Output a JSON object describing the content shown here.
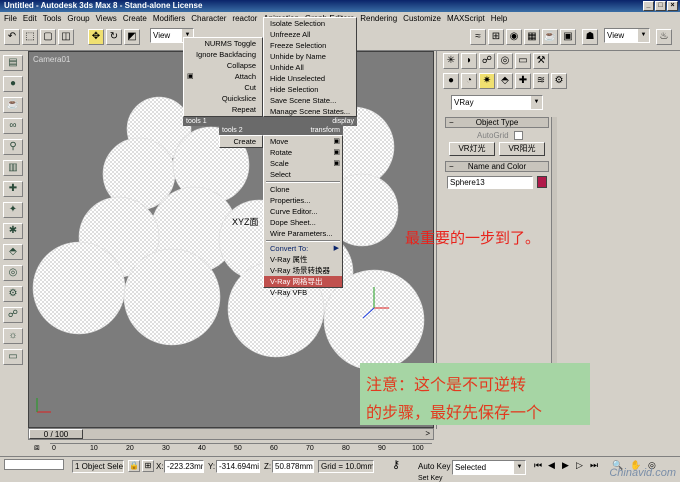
{
  "window": {
    "title": "Untitled - Autodesk 3ds Max 8  -  Stand-alone License",
    "controls": [
      "_",
      "□",
      "×"
    ]
  },
  "menubar": [
    "File",
    "Edit",
    "Tools",
    "Group",
    "Views",
    "Create",
    "Modifiers",
    "Character",
    "reactor",
    "Animation",
    "Graph Editors",
    "Rendering",
    "Customize",
    "MAXScript",
    "Help"
  ],
  "toolbar": {
    "view_combo": "View",
    "view_combo_right": "View"
  },
  "viewport": {
    "label": "Camera01",
    "center_label": "XYZ面"
  },
  "quad_left": {
    "items": [
      "NURMS Toggle",
      "Ignore Backfacing",
      "Collapse",
      "Attach",
      "Cut",
      "Quickslice",
      "Repeat"
    ],
    "header_left": "tools 1",
    "header2": "tools 2",
    "create": "Create"
  },
  "quad_right": {
    "items_top": [
      "Isolate Selection",
      "Unfreeze All",
      "Freeze Selection",
      "Unhide by Name",
      "Unhide All",
      "Hide Unselected",
      "Hide Selection",
      "Save Scene State...",
      "Manage Scene States..."
    ],
    "header_display": "display",
    "header_transform": "transform",
    "items_bottom": [
      "Move",
      "Rotate",
      "Scale",
      "Select",
      "Clone",
      "Properties...",
      "Curve Editor...",
      "Dope Sheet...",
      "Wire Parameters...",
      "Convert To:",
      "V-Ray 属性",
      "V-Ray 场景转换器",
      "V-Ray 网格导出",
      "V-Ray VFB"
    ]
  },
  "cmdpanel": {
    "renderer_combo": "VRay",
    "object_type_header": "Object Type",
    "autogrid": "AutoGrid",
    "btn_vrlight": "VR灯光",
    "btn_vrsun": "VR阳光",
    "name_color_header": "Name and Color",
    "object_name": "Sphere13",
    "object_color": "#b01a4a"
  },
  "timeline": {
    "frame": "0 / 100",
    "ticks": [
      "0",
      "10",
      "20",
      "30",
      "40",
      "50",
      "60",
      "70",
      "80",
      "90",
      "100"
    ]
  },
  "statusbar": {
    "selection": "1 Object Sele",
    "x_label": "X:",
    "x_value": "-223.23mm",
    "y_label": "Y:",
    "y_value": "-314.694mi",
    "z_label": "Z:",
    "z_value": "50.878mm",
    "grid": "Grid = 10.0mm",
    "autokey": "Auto Key",
    "selected": "Selected",
    "setkey": "Set Key"
  },
  "annotations": {
    "main": "最重要的一步到了。",
    "note_line1": "注意：这个是不可逆转",
    "note_line2": "的步骤，最好先保存一个",
    "watermark": "Chinavid.com"
  }
}
